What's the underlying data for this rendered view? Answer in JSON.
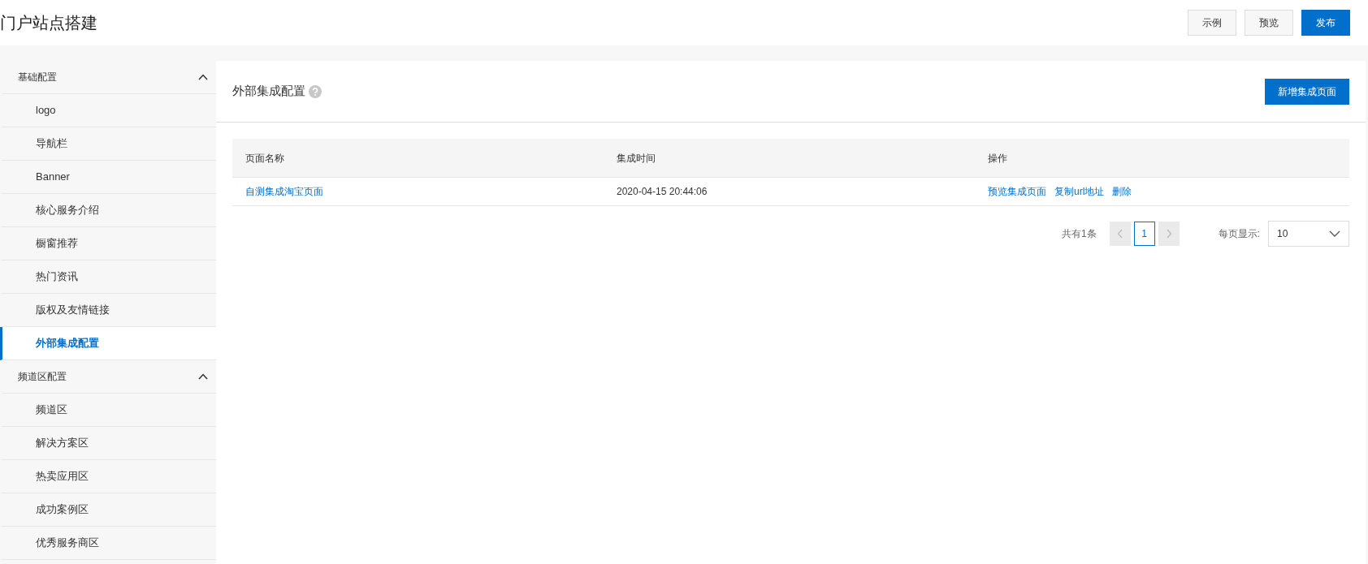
{
  "header": {
    "title": "门户站点搭建",
    "buttons": [
      {
        "label": "示例",
        "kind": "default"
      },
      {
        "label": "预览",
        "kind": "default"
      },
      {
        "label": "发布",
        "kind": "primary"
      }
    ]
  },
  "sidebar": {
    "groups": [
      {
        "label": "基础配置",
        "expanded": true,
        "items": [
          {
            "label": "logo",
            "selected": false
          },
          {
            "label": "导航栏",
            "selected": false
          },
          {
            "label": "Banner",
            "selected": false
          },
          {
            "label": "核心服务介绍",
            "selected": false
          },
          {
            "label": "橱窗推荐",
            "selected": false
          },
          {
            "label": "热门资讯",
            "selected": false
          },
          {
            "label": "版权及友情链接",
            "selected": false
          },
          {
            "label": "外部集成配置",
            "selected": true
          }
        ]
      },
      {
        "label": "频道区配置",
        "expanded": true,
        "items": [
          {
            "label": "频道区",
            "selected": false
          },
          {
            "label": "解决方案区",
            "selected": false
          },
          {
            "label": "热卖应用区",
            "selected": false
          },
          {
            "label": "成功案例区",
            "selected": false
          },
          {
            "label": "优秀服务商区",
            "selected": false
          }
        ]
      }
    ]
  },
  "panel": {
    "title": "外部集成配置",
    "add_button": "新增集成页面"
  },
  "table": {
    "columns": [
      "页面名称",
      "集成时间",
      "操作"
    ],
    "rows": [
      {
        "name": "自测集成淘宝页面",
        "time": "2020-04-15 20:44:06",
        "actions": [
          "预览集成页面",
          "复制url地址",
          "删除"
        ]
      }
    ]
  },
  "pagination": {
    "total": "共有1条",
    "prev_disabled": true,
    "next_disabled": true,
    "pages": [
      {
        "label": "1",
        "selected": true
      }
    ],
    "page_size_label": "每页显示:",
    "page_size": "10"
  }
}
